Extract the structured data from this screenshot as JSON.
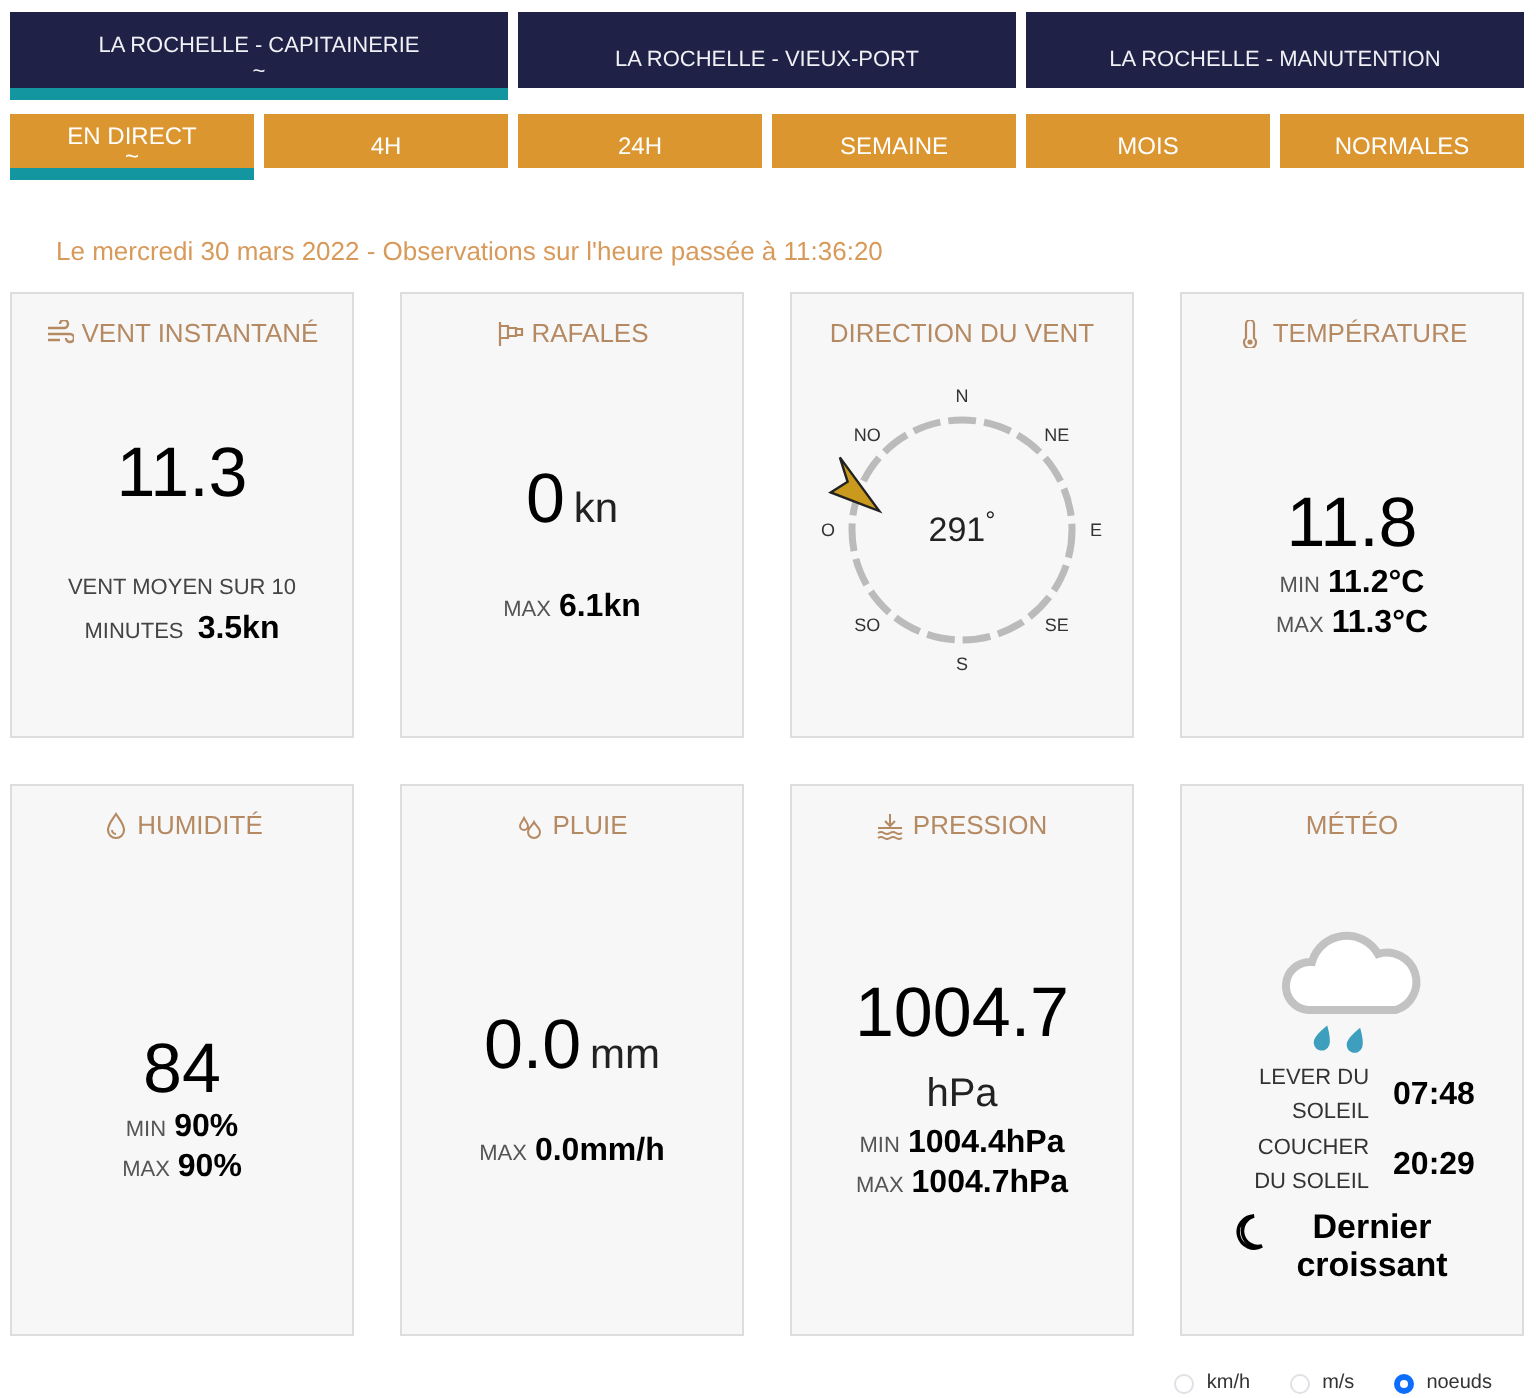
{
  "stations": [
    {
      "label": "LA ROCHELLE - CAPITAINERIE",
      "selected": true
    },
    {
      "label": "LA ROCHELLE - VIEUX-PORT",
      "selected": false
    },
    {
      "label": "LA ROCHELLE - MANUTENTION",
      "selected": false
    }
  ],
  "selected_marker": "~",
  "periods": [
    {
      "label": "EN DIRECT",
      "selected": true
    },
    {
      "label": "4H",
      "selected": false
    },
    {
      "label": "24H",
      "selected": false
    },
    {
      "label": "SEMAINE",
      "selected": false
    },
    {
      "label": "MOIS",
      "selected": false
    },
    {
      "label": "NORMALES",
      "selected": false
    }
  ],
  "timestamp": "Le mercredi 30 mars 2022 - Observations sur l'heure passée à 11:36:20",
  "cards": [
    {
      "kind": "wind",
      "title": "VENT INSTANTANÉ",
      "value": "11.3",
      "note": "VENT MOYEN SUR 10 MINUTES",
      "note_value": "3.5kn"
    },
    {
      "kind": "gust",
      "title": "RAFALES",
      "value": "0",
      "unit": "kn",
      "stats": [
        {
          "label": "MAX",
          "value": "6.1kn"
        }
      ]
    },
    {
      "kind": "direction",
      "title": "DIRECTION DU VENT",
      "reading": "291$^{°}$",
      "points": [
        "N",
        "NE",
        "E",
        "SE",
        "S",
        "SO",
        "O",
        "NO"
      ]
    },
    {
      "kind": "temperature",
      "title": "TEMPÉRATURE",
      "value": "11.8",
      "stats": [
        {
          "label": "MIN",
          "value": "11.2°C"
        },
        {
          "label": "MAX",
          "value": "11.3°C"
        }
      ]
    },
    {
      "kind": "humidity",
      "title": "HUMIDITÉ",
      "value": "84",
      "stats": [
        {
          "label": "MIN",
          "value": "90%"
        },
        {
          "label": "MAX",
          "value": "90%"
        }
      ]
    },
    {
      "kind": "rain",
      "title": "PLUIE",
      "value": "0.0",
      "unit": "mm",
      "stats": [
        {
          "label": "MAX",
          "value": "0.0mm/h"
        }
      ]
    },
    {
      "kind": "pressure",
      "title": "PRESSION",
      "value": "1004.7",
      "unit": "hPa",
      "stats": [
        {
          "label": "MIN",
          "value": "1004.4hPa"
        },
        {
          "label": "MAX",
          "value": "1004.7hPa"
        }
      ]
    },
    {
      "kind": "weather",
      "title": "MÉTÉO",
      "sun": [
        {
          "label": "LEVER DU SOLEIL",
          "value": "07:48"
        },
        {
          "label": "COUCHER DU SOLEIL",
          "value": "20:29"
        }
      ],
      "moon": "Dernier croissant"
    }
  ],
  "units": [
    {
      "label": "km/h",
      "selected": false
    },
    {
      "label": "m/s",
      "selected": false
    },
    {
      "label": "noeuds",
      "selected": true
    }
  ]
}
